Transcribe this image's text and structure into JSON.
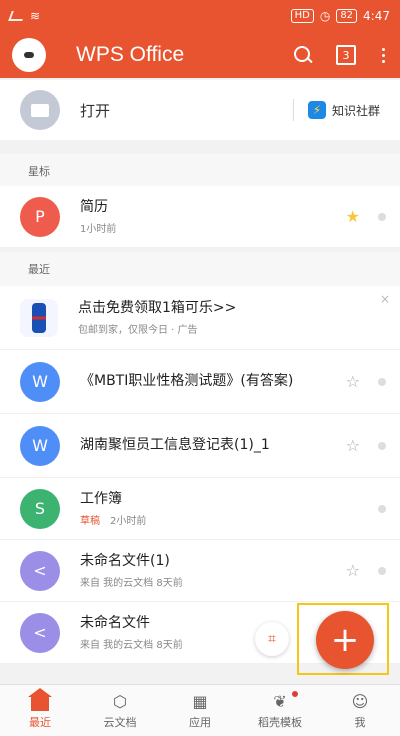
{
  "status": {
    "battery": "82",
    "time": "4:47",
    "hd": "HD"
  },
  "appbar": {
    "title": "WPS Office",
    "tab_count": "3"
  },
  "open": {
    "label": "打开",
    "community": "知识社群"
  },
  "starred": {
    "header": "星标",
    "item": {
      "name": "简历",
      "sub": "1小时前",
      "icon_letter": "P",
      "icon_color": "#ef5b4c"
    }
  },
  "recent": {
    "header": "最近",
    "ad": {
      "title": "点击免费领取1箱可乐>>",
      "sub": "包邮到家，仅限今日 · 广告",
      "close": "×"
    },
    "items": [
      {
        "name": "《MBTI职业性格测试题》(有答案)",
        "sub": "",
        "tag": "",
        "icon_letter": "W",
        "icon_color": "#4f8ef7"
      },
      {
        "name": "湖南聚恒员工信息登记表(1)_1",
        "sub": "",
        "tag": "",
        "icon_letter": "W",
        "icon_color": "#4f8ef7"
      },
      {
        "name": "工作簿",
        "sub": "2小时前",
        "tag": "草稿",
        "icon_letter": "S",
        "icon_color": "#3cb371"
      },
      {
        "name": "未命名文件(1)",
        "sub": "来自 我的云文档    8天前",
        "tag": "",
        "icon_letter": "<",
        "icon_color": "#9b8ee6"
      },
      {
        "name": "未命名文件",
        "sub": "来自 我的云文档    8天前",
        "tag": "",
        "icon_letter": "<",
        "icon_color": "#9b8ee6"
      }
    ]
  },
  "fab": {
    "label": "+"
  },
  "nav": [
    {
      "label": "最近",
      "icon": "home-icon"
    },
    {
      "label": "云文档",
      "icon": "cloud-doc-icon"
    },
    {
      "label": "应用",
      "icon": "apps-icon"
    },
    {
      "label": "稻壳模板",
      "icon": "template-icon"
    },
    {
      "label": "我",
      "icon": "profile-icon"
    }
  ],
  "colors": {
    "brand": "#e8542f",
    "star": "#f7c93a"
  }
}
